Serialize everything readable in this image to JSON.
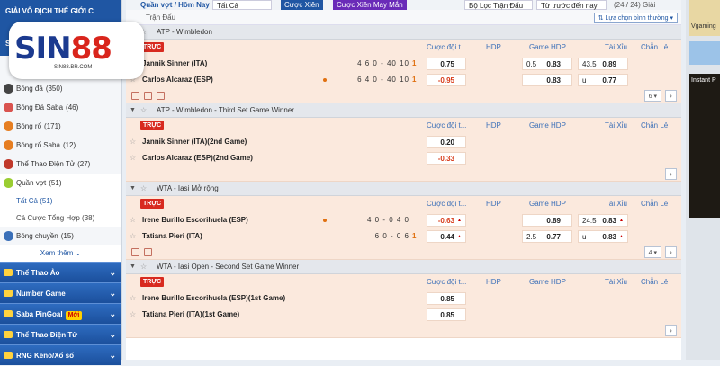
{
  "sidebar": {
    "top_rows": [
      "GIẢI VÔ ĐỊCH THẾ GIỚI C",
      "",
      "Số"
    ],
    "sports": [
      {
        "label": "Bóng đá",
        "count": "(350)",
        "color": "#444"
      },
      {
        "label": "Bóng Đá Saba",
        "count": "(46)",
        "color": "#d9534f"
      },
      {
        "label": "Bóng rổ",
        "count": "(171)",
        "color": "#e67e22"
      },
      {
        "label": "Bóng rổ Saba",
        "count": "(12)",
        "color": "#e67e22"
      },
      {
        "label": "Thể Thao Điện Tử",
        "count": "(27)",
        "color": "#c0392b"
      },
      {
        "label": "Quần vợt",
        "count": "(51)",
        "color": "#9acd32"
      }
    ],
    "tennis_subs": [
      {
        "label": "Tất Cả (51)"
      },
      {
        "label": "Cá Cược Tổng Hợp (38)"
      }
    ],
    "volleyball": {
      "label": "Bóng chuyền",
      "count": "(15)",
      "color": "#3a6fb8"
    },
    "more_label": "Xem thêm",
    "sections": [
      {
        "label": "Thể Thao Ảo",
        "badge": ""
      },
      {
        "label": "Number Game",
        "badge": ""
      },
      {
        "label": "Saba PinGoal",
        "badge": "Mới"
      },
      {
        "label": "Thể Thao Điện Tử",
        "badge": ""
      },
      {
        "label": "RNG Keno/Xổ số",
        "badge": ""
      }
    ]
  },
  "logo": {
    "text_a": "SIN",
    "text_b": "88",
    "url": "SIN88.BR.COM"
  },
  "topbar": {
    "title": "Quần vợt / Hôm Nay",
    "filter": "Tất Cả",
    "btn_parlay": "Cược Xiên",
    "btn_lucky": "Cược Xiên May Mắn",
    "match_filter": "Bộ Lọc Trận Đấu",
    "time_filter": "Từ trước đến nay",
    "count": "(24 / 24) Giải"
  },
  "crumb": {
    "label": "Trận Đấu",
    "sort": "Lựa chọn bình thường"
  },
  "columns": {
    "ml": "Cược đội t...",
    "hdp": "HDP",
    "game_hdp": "Game HDP",
    "ou": "Tài Xỉu",
    "oe": "Chẵn Lẻ",
    "live": "TRỰC"
  },
  "leagues": [
    {
      "name": "ATP - Wimbledon",
      "rows": [
        {
          "team": "Jannik Sinner (ITA)",
          "score": "4 6 0 - 40 10",
          "tot": "1",
          "dot": false,
          "ml": "0.75",
          "ml_neg": false,
          "ghdp_l": "0.5",
          "ghdp": "0.83",
          "ou_l": "43.5",
          "ou": "0.89",
          "up": false
        },
        {
          "team": "Carlos Alcaraz (ESP)",
          "score": "6 4 0 - 40 10",
          "tot": "1",
          "dot": true,
          "ml": "-0.95",
          "ml_neg": true,
          "ghdp_l": "",
          "ghdp": "0.83",
          "ou_l": "u",
          "ou": "0.77",
          "up": false
        }
      ],
      "icons": 3,
      "pager": "6"
    },
    {
      "name": "ATP - Wimbledon - Third Set Game Winner",
      "rows": [
        {
          "team": "Jannik Sinner (ITA)(2nd Game)",
          "score": "",
          "tot": "",
          "dot": false,
          "ml": "0.20",
          "ml_neg": false,
          "ghdp_l": "",
          "ghdp": "",
          "ou_l": "",
          "ou": "",
          "up": false
        },
        {
          "team": "Carlos Alcaraz (ESP)(2nd Game)",
          "score": "",
          "tot": "",
          "dot": false,
          "ml": "-0.33",
          "ml_neg": true,
          "ghdp_l": "",
          "ghdp": "",
          "ou_l": "",
          "ou": "",
          "up": false
        }
      ],
      "icons": 0,
      "pager": ""
    },
    {
      "name": "WTA - Iasi Mở rộng",
      "rows": [
        {
          "team": "Irene Burillo Escorihuela (ESP)",
          "score": "4 0 - 0 4 0",
          "tot": "",
          "dot": true,
          "ml": "-0.63",
          "ml_neg": true,
          "ghdp_l": "",
          "ghdp": "0.89",
          "ou_l": "24.5",
          "ou": "0.83",
          "up": true
        },
        {
          "team": "Tatiana Pieri (ITA)",
          "score": "6 0 - 0 6",
          "tot": "1",
          "dot": false,
          "ml": "0.44",
          "ml_neg": false,
          "ghdp_l": "2.5",
          "ghdp": "0.77",
          "ou_l": "u",
          "ou": "0.83",
          "up": true
        }
      ],
      "icons": 2,
      "pager": "4"
    },
    {
      "name": "WTA - Iasi Open - Second Set Game Winner",
      "rows": [
        {
          "team": "Irene Burillo Escorihuela (ESP)(1st Game)",
          "score": "",
          "tot": "",
          "dot": false,
          "ml": "0.85",
          "ml_neg": false,
          "ghdp_l": "",
          "ghdp": "",
          "ou_l": "",
          "ou": "",
          "up": false
        },
        {
          "team": "Tatiana Pieri (ITA)(1st Game)",
          "score": "",
          "tot": "",
          "dot": false,
          "ml": "0.85",
          "ml_neg": false,
          "ghdp_l": "",
          "ghdp": "",
          "ou_l": "",
          "ou": "",
          "up": false
        }
      ],
      "icons": 0,
      "pager": ""
    }
  ],
  "right_panel": {
    "label1": "Vgaming",
    "label2": "Instant P"
  },
  "colors": {
    "accent": "#1f56a3",
    "live": "#d82a1f",
    "row_bg": "#fbe9dd",
    "negative": "#d83b1a"
  }
}
